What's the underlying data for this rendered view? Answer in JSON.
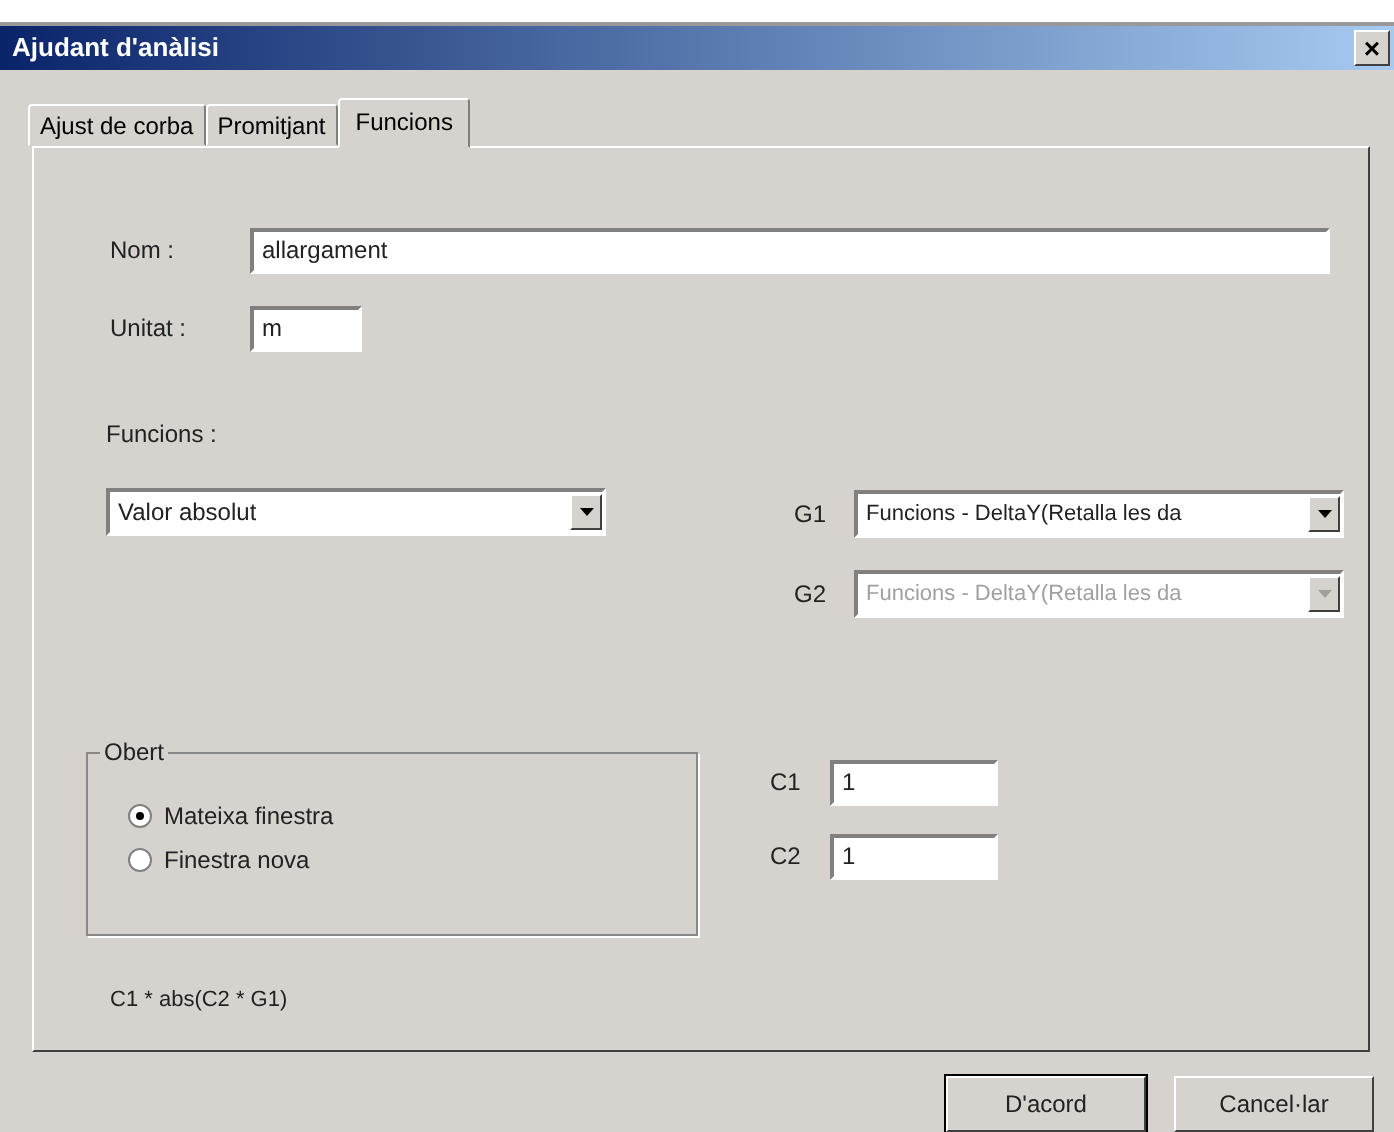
{
  "window": {
    "title": "Ajudant d'anàlisi",
    "close": "×"
  },
  "tabs": [
    {
      "label": "Ajust de corba",
      "selected": false
    },
    {
      "label": "Promitjant",
      "selected": false
    },
    {
      "label": "Funcions",
      "selected": true
    }
  ],
  "name": {
    "label": "Nom :",
    "value": "allargament"
  },
  "unit": {
    "label": "Unitat :",
    "value": "m"
  },
  "functions": {
    "label": "Funcions :",
    "value": "Valor absolut"
  },
  "graphs": [
    {
      "label": "G1",
      "value": "Funcions - DeltaY(Retalla les da",
      "disabled": false
    },
    {
      "label": "G2",
      "value": "Funcions - DeltaY(Retalla les da",
      "disabled": true
    }
  ],
  "open_group": {
    "title": "Obert",
    "options": [
      {
        "label": "Mateixa finestra",
        "selected": true
      },
      {
        "label": "Finestra nova",
        "selected": false
      }
    ]
  },
  "constants": [
    {
      "label": "C1",
      "value": "1"
    },
    {
      "label": "C2",
      "value": "1"
    }
  ],
  "formula": "C1 * abs(C2 * G1)",
  "buttons": [
    "D'acord",
    "Cancel·lar"
  ]
}
